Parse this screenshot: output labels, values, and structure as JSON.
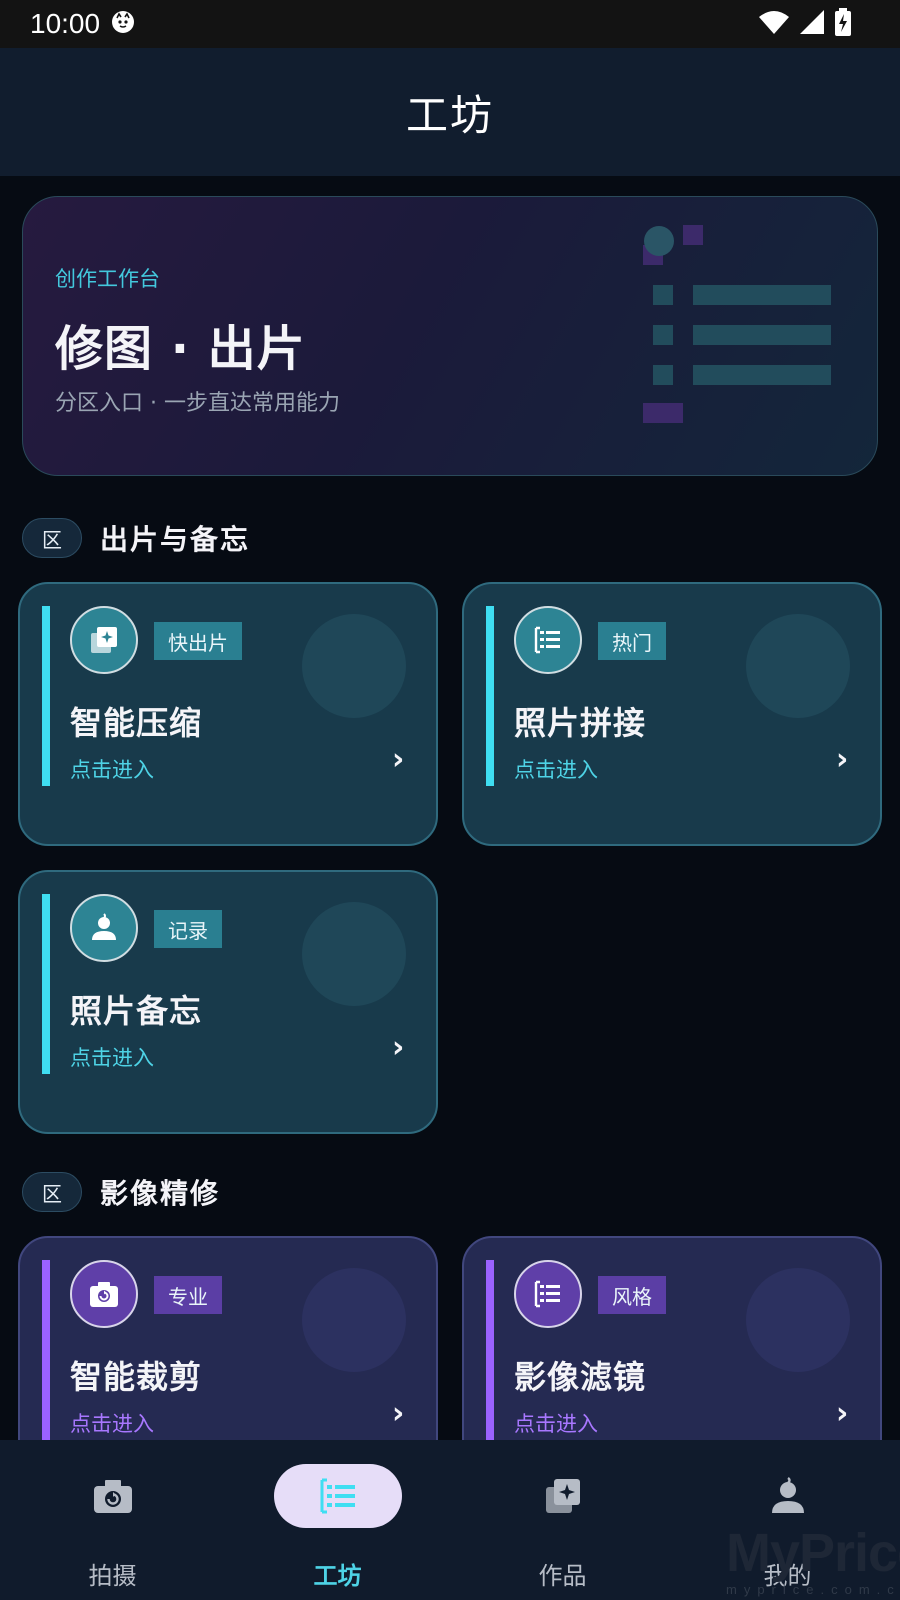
{
  "status_bar": {
    "time": "10:00",
    "icons": [
      "cat-notification-icon",
      "wifi-icon",
      "cellular-signal-icon",
      "battery-charging-icon"
    ]
  },
  "app_bar": {
    "title": "工坊"
  },
  "hero": {
    "kicker": "创作工作台",
    "title": "修图 · 出片",
    "subtitle": "分区入口 · 一步直达常用能力",
    "art_icon": "list-icon"
  },
  "sections": [
    {
      "badge": "区",
      "title": "出片与备忘",
      "theme": "teal",
      "cards": [
        {
          "icon": "photo-library-icon",
          "tag": "快出片",
          "title": "智能压缩",
          "action": "点击进入",
          "chevron": "›"
        },
        {
          "icon": "list-icon",
          "tag": "热门",
          "title": "照片拼接",
          "action": "点击进入",
          "chevron": "›"
        },
        {
          "icon": "person-icon",
          "tag": "记录",
          "title": "照片备忘",
          "action": "点击进入",
          "chevron": "›"
        }
      ]
    },
    {
      "badge": "区",
      "title": "影像精修",
      "theme": "violet",
      "cards": [
        {
          "icon": "camera-icon",
          "tag": "专业",
          "title": "智能裁剪",
          "action": "点击进入",
          "chevron": "›"
        },
        {
          "icon": "list-icon",
          "tag": "风格",
          "title": "影像滤镜",
          "action": "点击进入",
          "chevron": "›"
        }
      ]
    }
  ],
  "bottom_nav": {
    "active_index": 1,
    "items": [
      {
        "label": "拍摄",
        "icon": "camera-icon"
      },
      {
        "label": "工坊",
        "icon": "list-icon"
      },
      {
        "label": "作品",
        "icon": "photo-library-icon"
      },
      {
        "label": "我的",
        "icon": "person-icon"
      }
    ]
  },
  "watermark": {
    "main": "MyPrice",
    "sub": "myprice.com.cn"
  },
  "colors": {
    "background": "#060b13",
    "teal_accent": "#3fdef2",
    "violet_accent": "#9a62ff",
    "active_nav_pill": "#e6ddf8",
    "active_nav_label": "#4ed3e6"
  }
}
